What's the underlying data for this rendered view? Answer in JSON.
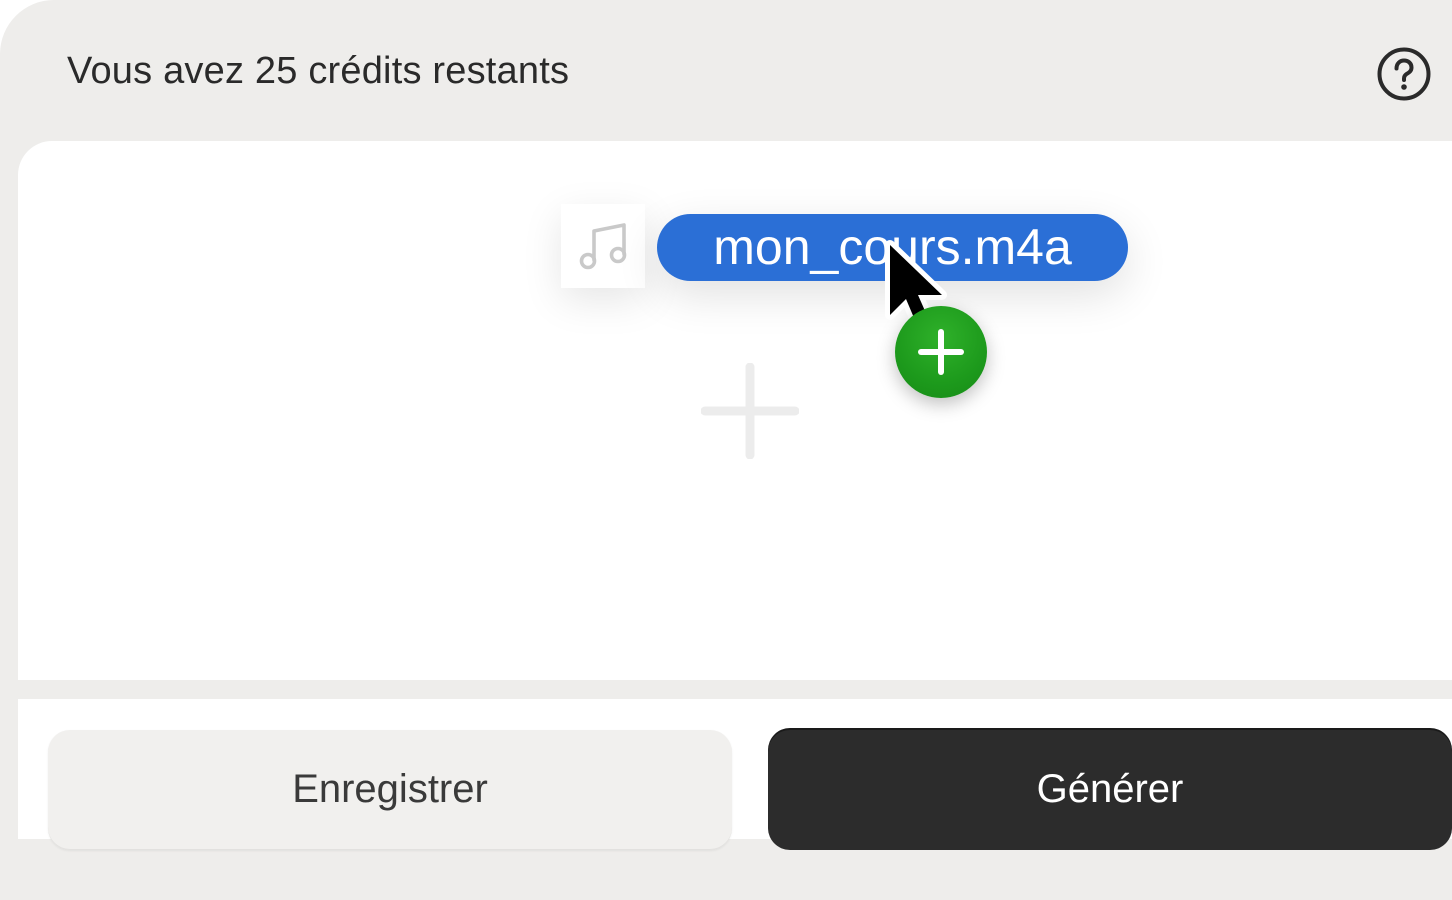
{
  "header": {
    "credits_text": "Vous avez 25 crédits restants",
    "help_icon": "question-circle-icon"
  },
  "dropzone": {
    "add_icon": "plus-icon"
  },
  "drag_ghost": {
    "file_icon": "music-note-icon",
    "file_name": "mon_cours.m4a",
    "copy_badge_icon": "add-copy-icon"
  },
  "actions": {
    "record_label": "Enregistrer",
    "generate_label": "Générer"
  },
  "colors": {
    "panel_bg": "#eeedeb",
    "accent_blue": "#2b6fd6",
    "copy_green": "#1d9a1c",
    "primary_dark": "#2c2c2c"
  }
}
